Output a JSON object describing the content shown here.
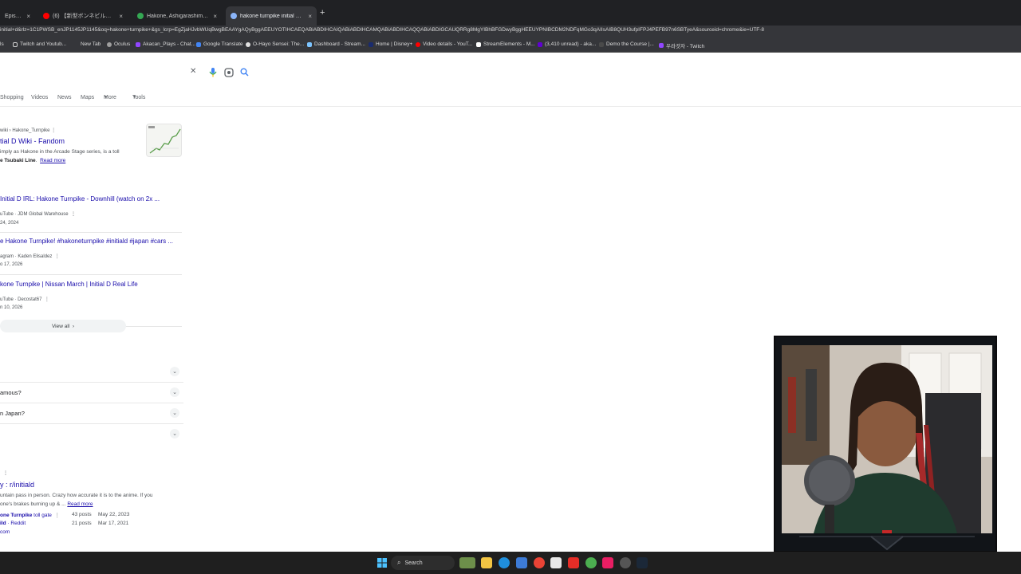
{
  "browser": {
    "tabs": [
      {
        "label": "Episode",
        "active": false
      },
      {
        "label": "(6) 【新型ボンネビルボバー1145cc",
        "active": false
      },
      {
        "label": "Hakone, Ashigarashimo District",
        "active": false
      },
      {
        "label": "hakone turnpike initial d - Goo",
        "active": true
      }
    ],
    "new_tab_symbol": "+",
    "close_symbol": "×",
    "url": "initial+d&rlz=1C1PWSB_enJP1145JP1145&oq=hakone+turnpike+&gs_lcrp=EgZjaHJvbWUqBwgBEAAYgAQyBggAEEUYOTIHCAEQABiABDIHCAIQABiABDIHCAMQABiABDIHCAQQABiABDIGCAUQRRg8MgYIBhBFGDwyBggHEEUYPNIBCDM2NDFqMGo3qAIIsAIB8QUH3ufpIFPJ4PEFB97n6SBTyeA&sourceid=chrome&ie=UTF-8",
    "bookmarks": [
      {
        "label": "ls"
      },
      {
        "label": "Twitch and Youtub..."
      },
      {
        "label": "New Tab"
      },
      {
        "label": "Oculus"
      },
      {
        "label": "Akacan_Plays - Chat..."
      },
      {
        "label": "Google Translate"
      },
      {
        "label": "O-Hayo Sensei: The..."
      },
      {
        "label": "Dashboard - Stream..."
      },
      {
        "label": "Home | Disney+"
      },
      {
        "label": "Video details - YouT..."
      },
      {
        "label": "StreamElements - M..."
      },
      {
        "label": "(3,410 unread) - aka..."
      },
      {
        "label": "Demo the Course |..."
      },
      {
        "label": "우라것자 - Twitch"
      }
    ]
  },
  "search": {
    "tabs": [
      "Shopping",
      "Videos",
      "News",
      "Maps",
      "More",
      "Tools"
    ],
    "clear_symbol": "✕"
  },
  "results": {
    "fandom": {
      "breadcrumb": "wiki › Hakone_Turnpike",
      "title": "tial D Wiki - Fandom",
      "snippet1": "imply as Hakone in the Arcade Stage series, is a toll",
      "snippet2_bold": "e Tsubaki Line",
      "snippet2_tail": ".",
      "read_more": "Read more"
    },
    "videos": [
      {
        "title": "Initial D IRL: Hakone Turnpike - Downhill (watch on 2x ...",
        "source": "uTube · JDM Global Warehouse",
        "date": "24, 2024"
      },
      {
        "title": "e Hakone Turnpike! #hakoneturnpike #initiald #japan #cars ...",
        "source": "agram · Kaden Elisaldez",
        "date": "o 17, 2026"
      },
      {
        "title": "kone Turnpike | Nissan March | Initial D Real Life",
        "source": "uTube · Decostat67",
        "date": "n 10, 2026"
      }
    ],
    "view_all": "View all",
    "paa": [
      "",
      "amous?",
      "n Japan?",
      ""
    ],
    "reddit": {
      "title": "y : r/initiald",
      "snippet1": "untain pass in person. Crazy how accurate it is to the anime. If you",
      "snippet2": "one's brakes burning up & ...",
      "read_more": "Read more",
      "sub1_bold": "one Turnpike",
      "sub1_tail": " toll gate",
      "sub1_posts": "43 posts",
      "sub1_date": "May 22, 2023",
      "sub2_bold": "ild",
      "sub2_tail": " · Reddit",
      "sub2_posts": "21 posts",
      "sub2_date": "Mar 17, 2021",
      "domain": "com"
    }
  },
  "taskbar": {
    "search_label": "Search"
  },
  "colors": {
    "link": "#1a0dab",
    "tabbar": "#202124",
    "toolbar": "#35363a",
    "taskbar": "#1f1f1f"
  }
}
